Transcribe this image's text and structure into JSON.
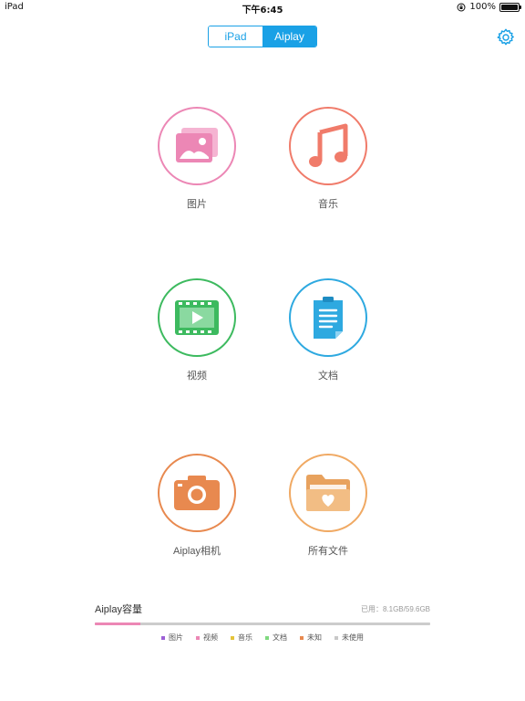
{
  "status_bar": {
    "device": "iPad",
    "time": "下午6:45",
    "battery": "100%",
    "battery_level": 1.0
  },
  "segmented_control": {
    "left_label": "iPad",
    "right_label": "Aiplay",
    "selected": "Aiplay",
    "accent_color": "#1aa1e6"
  },
  "settings": {
    "icon": "gear-icon"
  },
  "grid": {
    "photos": {
      "label": "图片",
      "icon": "photos-icon",
      "color": "#ec87b5"
    },
    "music": {
      "label": "音乐",
      "icon": "music-note-icon",
      "color": "#f07b6a"
    },
    "videos": {
      "label": "视频",
      "icon": "film-icon",
      "color": "#3dba5f"
    },
    "documents": {
      "label": "文档",
      "icon": "document-icon",
      "color": "#2ea9e0"
    },
    "camera": {
      "label": "Aiplay相机",
      "icon": "camera-icon",
      "color": "#e8894f"
    },
    "all_files": {
      "label": "所有文件",
      "icon": "folder-heart-icon",
      "color": "#f0a963"
    }
  },
  "storage": {
    "title": "Aiplay容量",
    "used_text": "已用：8.1GB/59.6GB",
    "used_fraction": 0.136,
    "fill_color": "#ec87b5",
    "track_color": "#cccccc",
    "legend": [
      {
        "label": "图片",
        "color": "#9c5fd6"
      },
      {
        "label": "视频",
        "color": "#ec87b5"
      },
      {
        "label": "音乐",
        "color": "#e5c43a"
      },
      {
        "label": "文档",
        "color": "#7fd97f"
      },
      {
        "label": "未知",
        "color": "#e8894f"
      },
      {
        "label": "未使用",
        "color": "#c8c8c8"
      }
    ]
  }
}
